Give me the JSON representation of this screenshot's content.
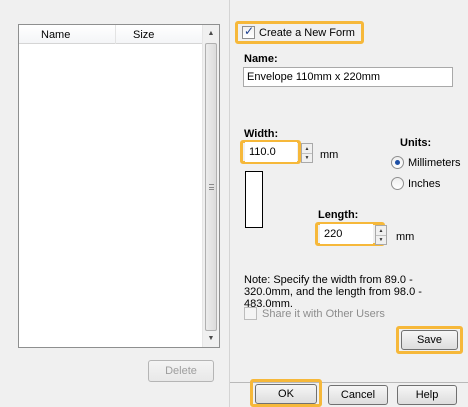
{
  "forms_list": {
    "columns": [
      "Name",
      "Size"
    ],
    "delete_label": "Delete"
  },
  "create_form": {
    "checkbox_label": "Create a New Form",
    "checked": true
  },
  "name": {
    "label": "Name:",
    "value": "Envelope 110mm x 220mm"
  },
  "width": {
    "label": "Width:",
    "value": "110.0",
    "unit": "mm"
  },
  "length": {
    "label": "Length:",
    "value": "220",
    "unit": "mm"
  },
  "units": {
    "label": "Units:",
    "options": [
      "Millimeters",
      "Inches"
    ],
    "selected": "Millimeters"
  },
  "note": "Note: Specify the width from 89.0 - 320.0mm, and the length from  98.0 - 483.0mm.",
  "share": {
    "label": "Share it with Other Users",
    "checked": false
  },
  "buttons": {
    "save": "Save",
    "ok": "OK",
    "cancel": "Cancel",
    "help": "Help"
  },
  "colors": {
    "highlight": "#f6b83a",
    "radio_selected": "#1d4fa6"
  }
}
